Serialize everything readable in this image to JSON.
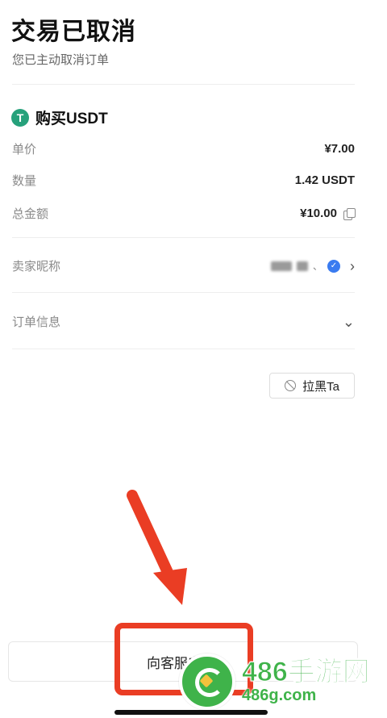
{
  "header": {
    "title": "交易已取消",
    "subtitle": "您已主动取消订单"
  },
  "asset": {
    "icon": "tether-icon",
    "icon_glyph": "T",
    "title": "购买USDT"
  },
  "details": [
    {
      "label": "单价",
      "value": "¥7.00"
    },
    {
      "label": "数量",
      "value": "1.42 USDT"
    },
    {
      "label": "总金额",
      "value": "¥10.00"
    }
  ],
  "seller": {
    "label": "卖家昵称",
    "suffix": "、",
    "verified_icon": "✓"
  },
  "order_info": {
    "label": "订单信息"
  },
  "block_button": {
    "label": "拉黑Ta"
  },
  "contact": {
    "label": "向客服申诉"
  },
  "watermark": {
    "title": "486手游网",
    "domain": "486g.com"
  },
  "colors": {
    "tether": "#26a17b",
    "verified": "#3a7bf0",
    "highlight": "#ea3d24",
    "watermark": "#3fb34a"
  }
}
